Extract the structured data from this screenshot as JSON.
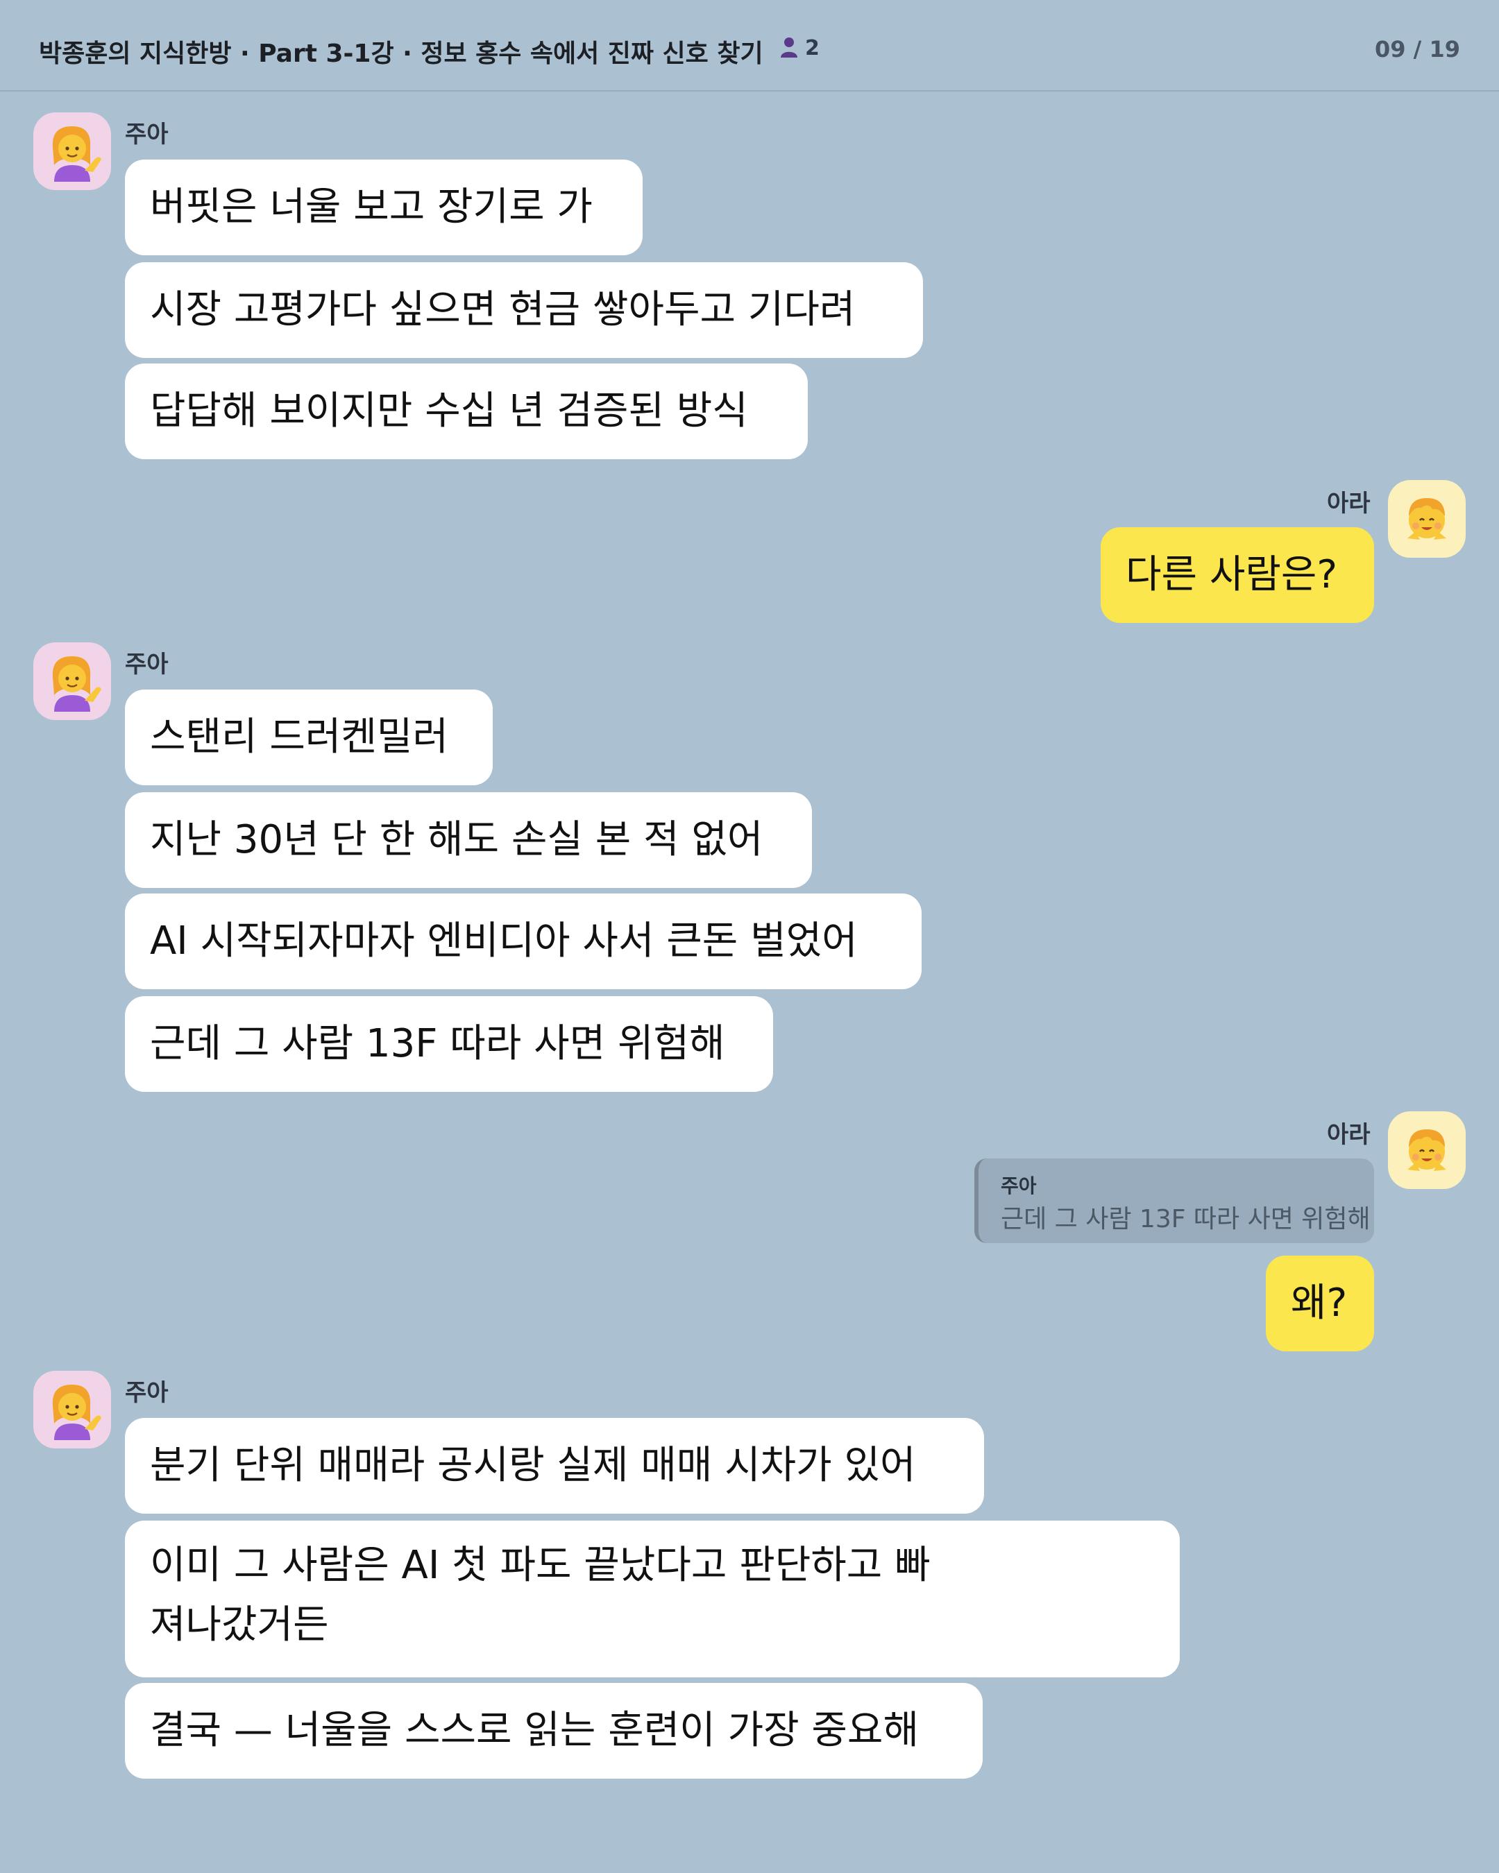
{
  "header": {
    "title": "박종훈의 지식한방 · Part 3-1강 · 정보 홍수 속에서 진짜 신호 찾기",
    "member_count": "2",
    "page_indicator": "09 / 19"
  },
  "participants": {
    "joa": {
      "name": "주아",
      "avatar_icon": "woman-tipping-hand-emoji"
    },
    "ara": {
      "name": "아라",
      "avatar_icon": "smiling-child-emoji"
    }
  },
  "messages": {
    "group1": {
      "sender": "주아",
      "bubbles": [
        "버핏은 너울 보고 장기로 가",
        "시장 고평가다 싶으면 현금 쌓아두고 기다려",
        "답답해 보이지만 수십 년 검증된 방식"
      ]
    },
    "group2": {
      "sender": "아라",
      "bubbles": [
        "다른 사람은?"
      ]
    },
    "group3": {
      "sender": "주아",
      "bubbles": [
        "스탠리 드러켄밀러",
        "지난 30년 단 한 해도 손실 본 적 없어",
        "AI 시작되자마자 엔비디아 사서 큰돈 벌었어",
        "근데 그 사람 13F 따라 사면 위험해"
      ]
    },
    "group4": {
      "sender": "아라",
      "quote": {
        "name": "주아",
        "text": "근데 그 사람 13F 따라 사면 위험해"
      },
      "bubbles": [
        "왜?"
      ]
    },
    "group5": {
      "sender": "주아",
      "bubbles": [
        "분기 단위 매매라 공시랑 실제 매매 시차가 있어",
        "이미 그 사람은 AI 첫 파도 끝났다고 판단하고 빠져나갔거든",
        "결국 — 너울을 스스로 읽는 훈련이 가장 중요해"
      ]
    }
  },
  "colors": {
    "background": "#abc1d1",
    "incoming_bubble": "#ffffff",
    "outgoing_bubble": "#fbe64d",
    "joa_avatar_bg": "#f1d4e7",
    "ara_avatar_bg": "#fcf0bd"
  }
}
